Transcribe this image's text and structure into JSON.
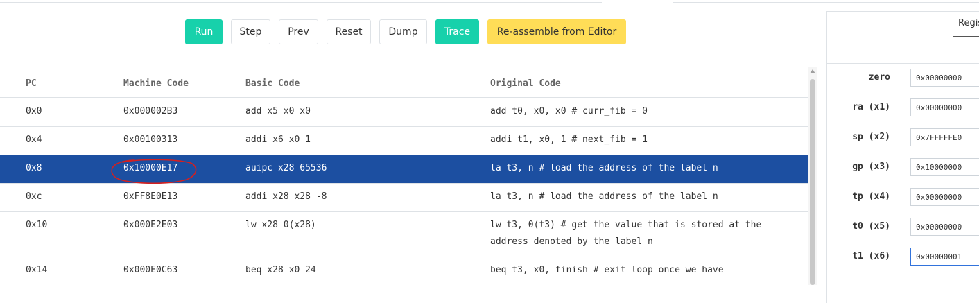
{
  "toolbar": {
    "run": "Run",
    "step": "Step",
    "prev": "Prev",
    "reset": "Reset",
    "dump": "Dump",
    "trace": "Trace",
    "reassemble": "Re-assemble from Editor"
  },
  "table": {
    "headers": {
      "pc": "PC",
      "machine_code": "Machine Code",
      "basic_code": "Basic Code",
      "original_code": "Original Code"
    },
    "rows": [
      {
        "pc": "0x0",
        "machine_code": "0x000002B3",
        "basic_code": "add x5 x0 x0",
        "original_code": "add t0, x0, x0 # curr_fib = 0"
      },
      {
        "pc": "0x4",
        "machine_code": "0x00100313",
        "basic_code": "addi x6 x0 1",
        "original_code": "addi t1, x0, 1 # next_fib = 1"
      },
      {
        "pc": "0x8",
        "machine_code": "0x10000E17",
        "basic_code": "auipc x28 65536",
        "original_code": "la t3, n # load the address of the label n"
      },
      {
        "pc": "0xc",
        "machine_code": "0xFF8E0E13",
        "basic_code": "addi x28 x28 -8",
        "original_code": "la t3, n # load the address of the label n"
      },
      {
        "pc": "0x10",
        "machine_code": "0x000E2E03",
        "basic_code": "lw x28 0(x28)",
        "original_code": "lw t3, 0(t3) # get the value that is stored at the address denoted by the label n"
      },
      {
        "pc": "0x14",
        "machine_code": "0x000E0C63",
        "basic_code": "beq x28 x0 24",
        "original_code": "beq t3, x0, finish # exit loop once we have"
      }
    ],
    "selected_pc": "0x8"
  },
  "registers_panel": {
    "tab_label": "Regis",
    "registers": [
      {
        "name": "zero",
        "value": "0x00000000"
      },
      {
        "name": "ra (x1)",
        "value": "0x00000000"
      },
      {
        "name": "sp (x2)",
        "value": "0x7FFFFFE0"
      },
      {
        "name": "gp (x3)",
        "value": "0x10000000"
      },
      {
        "name": "tp (x4)",
        "value": "0x00000000"
      },
      {
        "name": "t0 (x5)",
        "value": "0x00000000"
      },
      {
        "name": "t1 (x6)",
        "value": "0x00000001"
      }
    ]
  },
  "colors": {
    "selected_row": "#1c4fa1",
    "teal_button": "#17d1ab",
    "yellow_button": "#ffdd57",
    "annotation": "#d42020"
  }
}
